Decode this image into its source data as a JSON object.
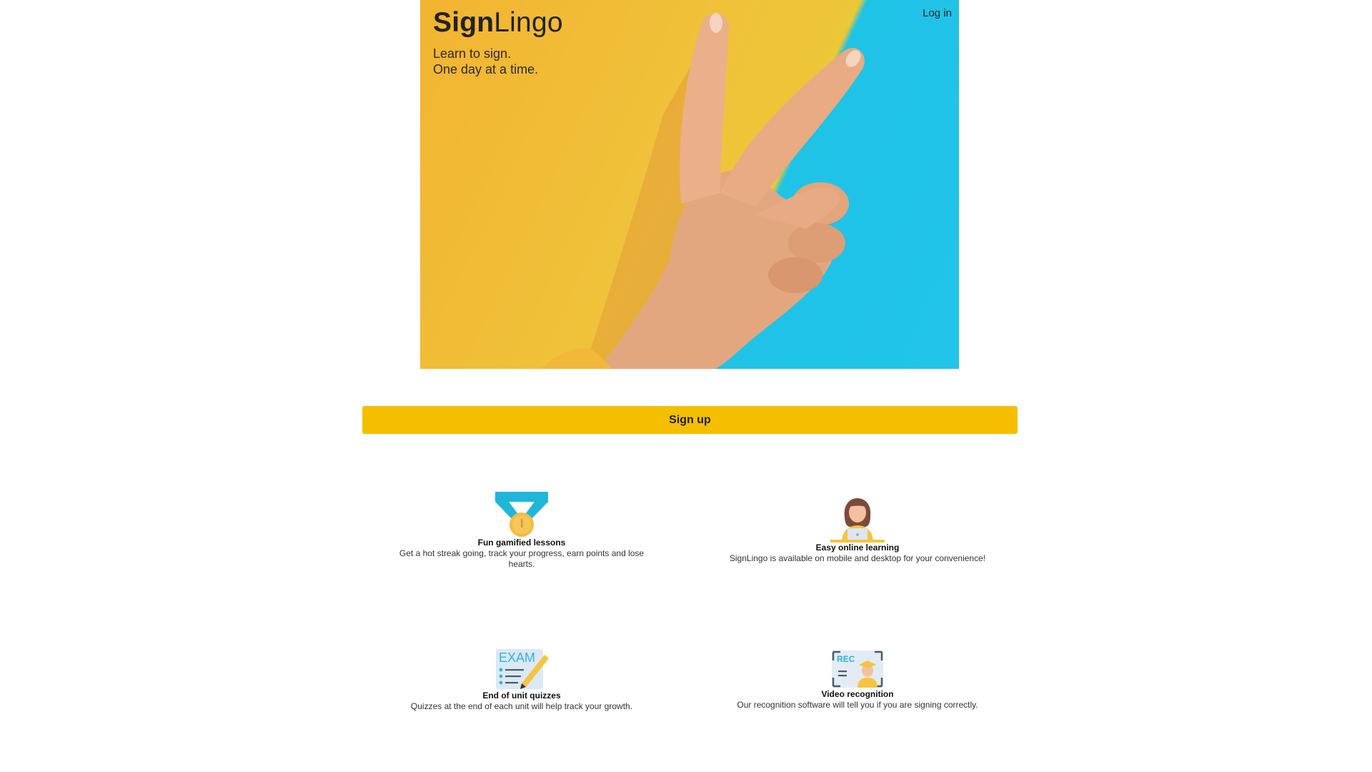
{
  "brand": {
    "name_bold": "Sign",
    "name_regular": "Lingo",
    "tagline_line1": "Learn to sign.",
    "tagline_line2": "One day at a time."
  },
  "nav": {
    "login_label": "Log in"
  },
  "cta": {
    "signup_label": "Sign up"
  },
  "features": [
    {
      "icon": "medal-icon",
      "title": "Fun gamified lessons",
      "description": "Get a hot streak going, track your progress, earn points and lose hearts."
    },
    {
      "icon": "laptop-learner-icon",
      "title": "Easy online learning",
      "description": "SignLingo is available on mobile and desktop for your convenience!"
    },
    {
      "icon": "exam-icon",
      "title": "End of unit quizzes",
      "description": "Quizzes at the end of each unit will help track your growth."
    },
    {
      "icon": "video-recognition-icon",
      "title": "Video recognition",
      "description": "Our recognition software will tell you if you are signing correctly.",
      "icon_text": "REC"
    }
  ],
  "colors": {
    "accent": "#f5bf00",
    "hero_yellow": "#f0c23a",
    "hero_blue": "#22c4ea"
  },
  "hero_image": "peace-sign-hand-photo"
}
